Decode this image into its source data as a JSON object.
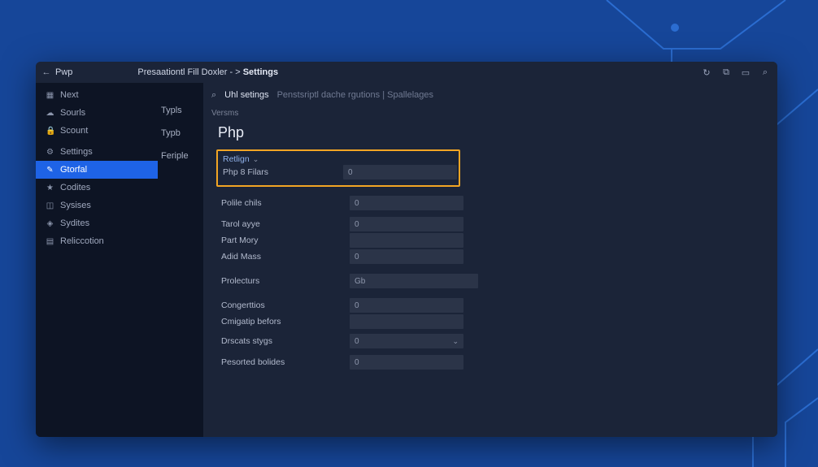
{
  "window": {
    "back_label": "Pwp",
    "path_prefix": "Presaationtl Fill Doxler - >",
    "path_current": "Settings"
  },
  "title_icons": [
    "refresh-icon",
    "copy-icon",
    "rect-icon",
    "search-icon"
  ],
  "sidebar": {
    "items": [
      {
        "icon": "grid",
        "label": "Next"
      },
      {
        "icon": "cloud",
        "label": "Sourls"
      },
      {
        "icon": "lock",
        "label": "Scount"
      },
      {
        "icon": "sliders",
        "label": "Settings"
      },
      {
        "icon": "pencil",
        "label": "Gtorfal",
        "active": true
      },
      {
        "icon": "star",
        "label": "Codites"
      },
      {
        "icon": "box",
        "label": "Sysises"
      },
      {
        "icon": "bookmark",
        "label": "Sydites"
      },
      {
        "icon": "tiles",
        "label": "Reliccotion"
      }
    ]
  },
  "subcol": {
    "items": [
      "Typls",
      "Typb",
      "Feriple"
    ]
  },
  "toolbar": {
    "tab_main": "Uhl setings",
    "tab_sub": "Penstsriptl dache rgutions | Spallelages"
  },
  "crumb": "Versms",
  "heading": "Php",
  "highlight": {
    "retlign_label": "Retlign",
    "label": "Php 8 Filars",
    "value": "0"
  },
  "fields": [
    {
      "label": "Polile chils",
      "value": "0"
    },
    {
      "spacer": 6
    },
    {
      "label": "Tarol ayye",
      "value": "0"
    },
    {
      "label": "Part Mory",
      "value": ""
    },
    {
      "label": "Adid Mass",
      "value": "0"
    },
    {
      "spacer": 10
    },
    {
      "label": "Prolecturs",
      "value": "Gb",
      "wide": true
    },
    {
      "spacer": 10
    },
    {
      "label": "Congerttios",
      "value": "0"
    },
    {
      "label": "Cmigatip befors",
      "value": ""
    },
    {
      "spacer": 4
    },
    {
      "label": "Drscats stygs",
      "value": "0",
      "select": true
    },
    {
      "spacer": 6
    },
    {
      "label": "Pesorted bolides",
      "value": "0"
    }
  ],
  "icon_glyphs": {
    "grid": "▦",
    "cloud": "☁",
    "lock": "🔒",
    "sliders": "⚙",
    "pencil": "✎",
    "star": "★",
    "box": "◫",
    "bookmark": "◈",
    "tiles": "▤",
    "refresh-icon": "↻",
    "copy-icon": "⧉",
    "rect-icon": "▭",
    "search-icon": "⌕"
  }
}
